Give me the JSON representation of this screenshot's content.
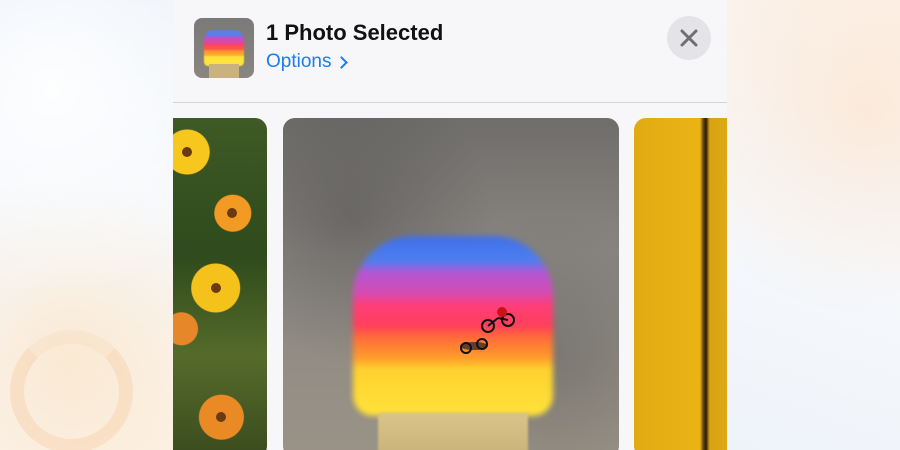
{
  "header": {
    "title": "1 Photo Selected",
    "options_label": "Options"
  },
  "icons": {
    "close": "close-icon",
    "options_chevron": "chevron-right-icon",
    "thumbnail": "selected-photo-thumbnail"
  },
  "colors": {
    "accent": "#1b7df0",
    "sheet_background": "#f7f7f9",
    "close_button_bg": "#e4e4e8"
  },
  "photos": [
    {
      "id": "flowers",
      "description_name": "photo-flowers"
    },
    {
      "id": "rainbow-chalk",
      "description_name": "photo-rainbow"
    },
    {
      "id": "yellow-wall",
      "description_name": "photo-yellow"
    }
  ]
}
